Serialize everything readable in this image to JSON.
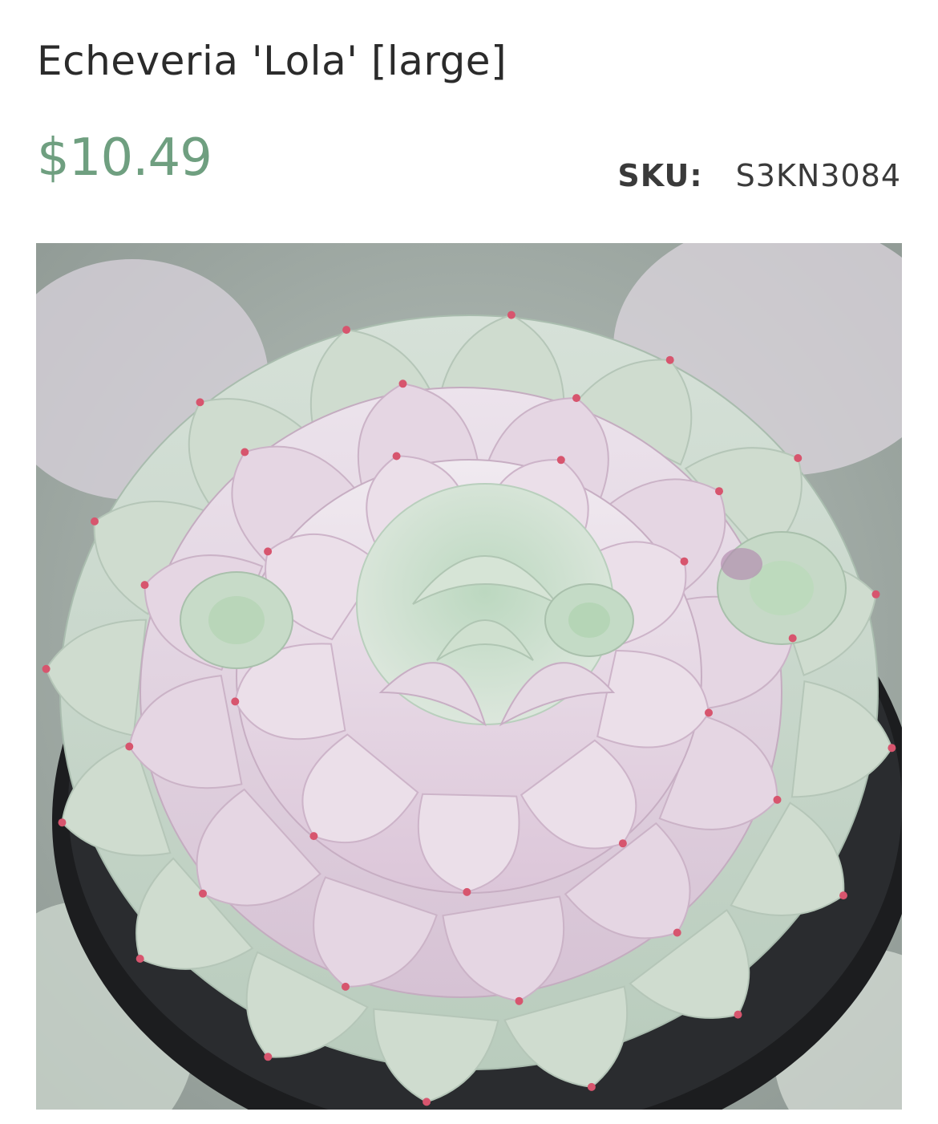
{
  "product": {
    "title": "Echeveria 'Lola' [large]",
    "price": "$10.49",
    "sku_label": "SKU:",
    "sku_value": "S3KN3084"
  },
  "image": {
    "subject": "succulent-rosette-photo"
  },
  "colors": {
    "title": "#2b2b2b",
    "price": "#6f9f80",
    "sku": "#3a3a3a",
    "leaf_light": "#e7e2ea",
    "leaf_pink": "#d9c3d6",
    "leaf_green": "#c9d9cb",
    "leaf_tip": "#d7556e",
    "pot": "#1c1d1f"
  }
}
